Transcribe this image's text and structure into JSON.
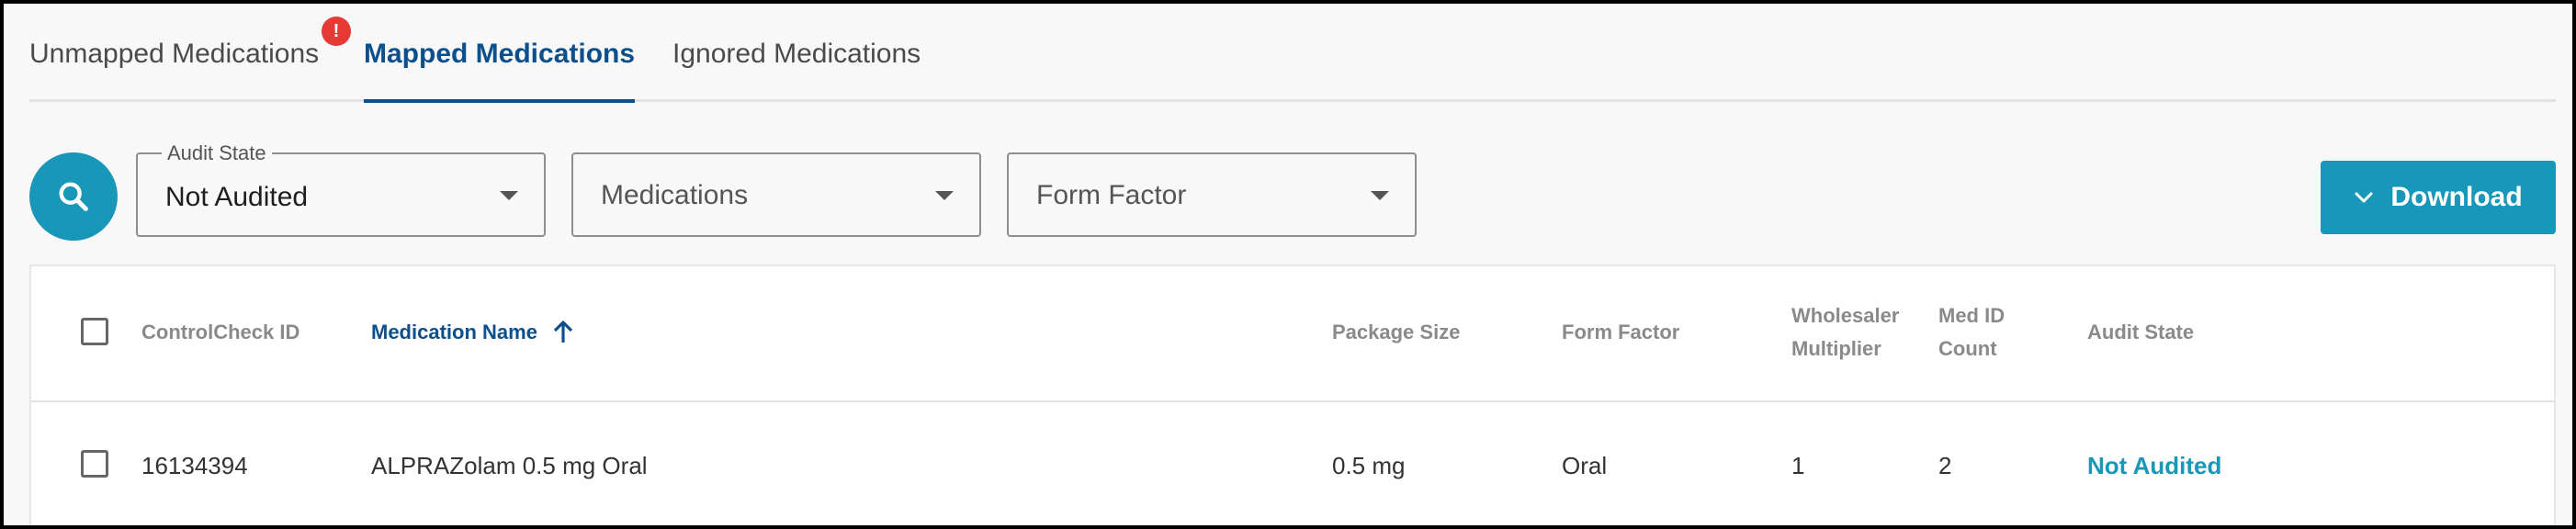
{
  "tabs": [
    {
      "label": "Unmapped Medications",
      "active": false,
      "badge": "!"
    },
    {
      "label": "Mapped Medications",
      "active": true
    },
    {
      "label": "Ignored Medications",
      "active": false
    }
  ],
  "filters": {
    "audit_state": {
      "legend": "Audit State",
      "value": "Not Audited"
    },
    "medications": {
      "placeholder": "Medications"
    },
    "form_factor": {
      "placeholder": "Form Factor"
    }
  },
  "download": {
    "label": "Download"
  },
  "table": {
    "columns": [
      {
        "line1": "ControlCheck ID"
      },
      {
        "line1": "Medication Name",
        "sorted": "asc"
      },
      {
        "line1": "Package Size"
      },
      {
        "line1": "Form Factor"
      },
      {
        "line1": "Wholesaler",
        "line2": "Multiplier"
      },
      {
        "line1": "Med ID",
        "line2": "Count"
      },
      {
        "line1": "Audit State"
      }
    ],
    "rows": [
      {
        "controlcheck_id": "16134394",
        "medication_name": "ALPRAZolam 0.5 mg Oral",
        "package_size": "0.5 mg",
        "form_factor": "Oral",
        "wholesaler_multiplier": "1",
        "med_id_count": "2",
        "audit_state": "Not Audited"
      }
    ]
  },
  "colors": {
    "primary": "#1997b8",
    "active_tab": "#0d4f8b",
    "alert": "#e53935"
  }
}
